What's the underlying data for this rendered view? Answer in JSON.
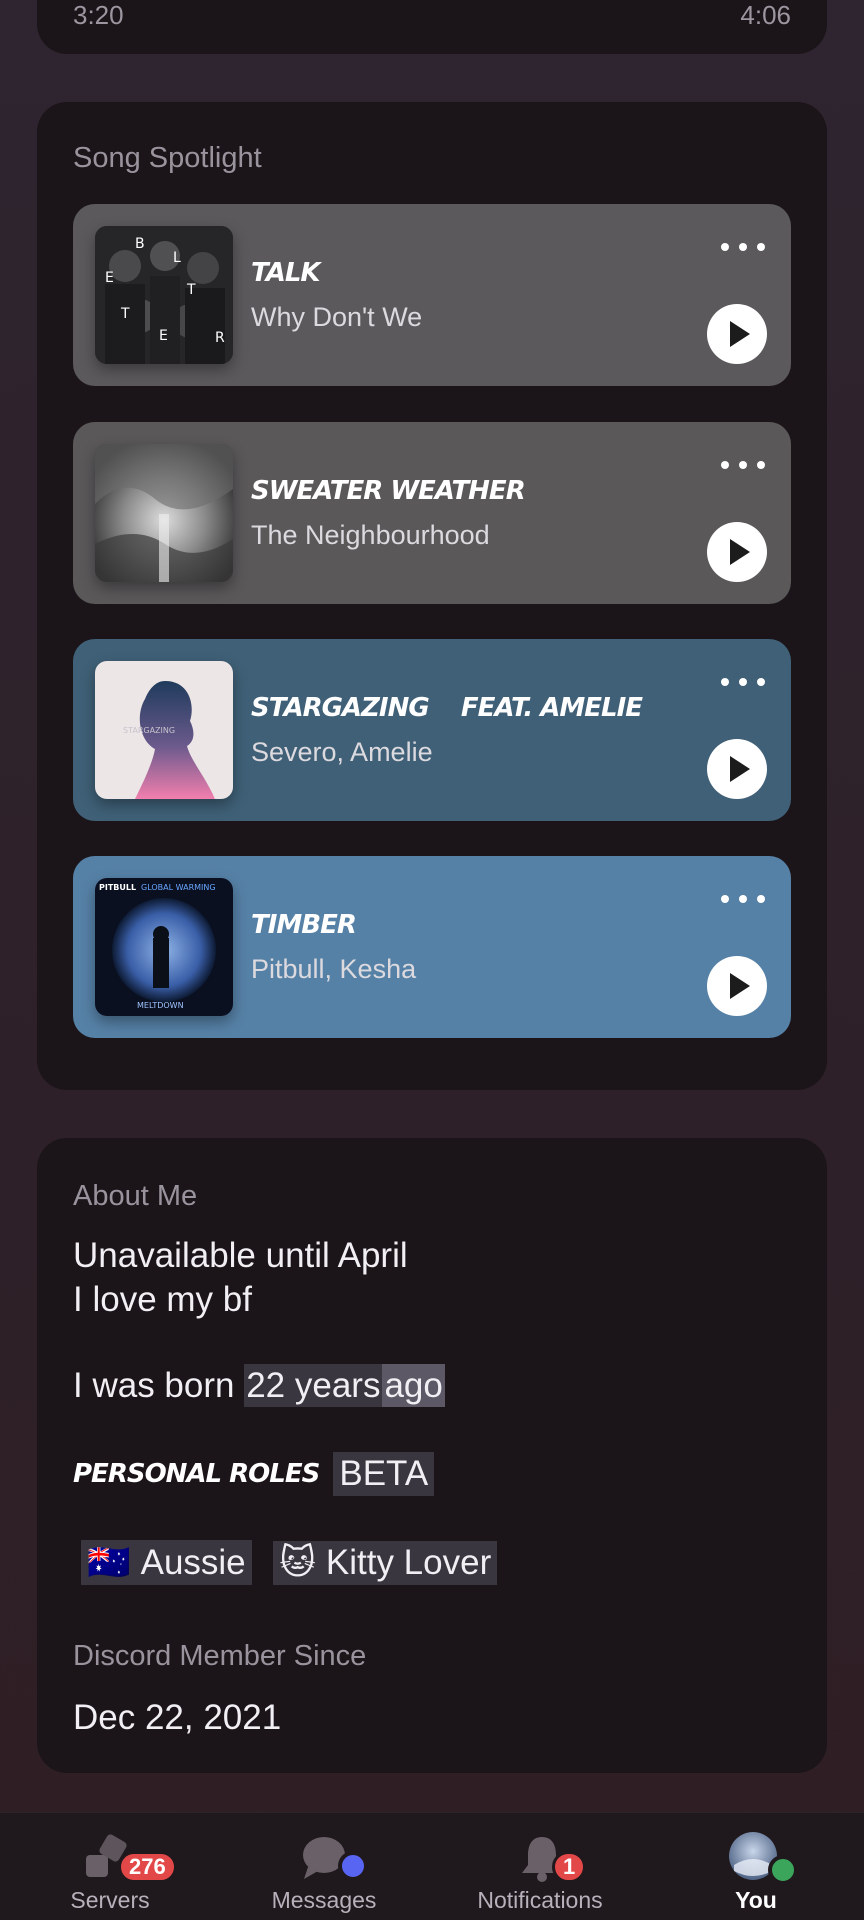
{
  "progress": {
    "elapsed": "3:20",
    "total": "4:06"
  },
  "spotlight": {
    "title": "Song Spotlight",
    "songs": [
      {
        "title": "TALK",
        "artist": "Why Don't We",
        "bg": "#5b595c"
      },
      {
        "title": "SWEATER WEATHER",
        "artist": "The Neighbourhood",
        "bg": "#5a5859"
      },
      {
        "title": "STARGAZING    FEAT. AMELIE",
        "artist": "Severo, Amelie",
        "bg": "#3f6077"
      },
      {
        "title": "TIMBER",
        "artist": "Pitbull, Kesha",
        "bg": "#5681a6"
      }
    ]
  },
  "about": {
    "title": "About Me",
    "line1": "Unavailable until April",
    "line2": "I love my bf",
    "born_prefix": "I was born",
    "born_highlight": "22 years",
    "born_suffix": "ago",
    "roles_label": "PERSONAL ROLES",
    "roles_badge": "BETA",
    "roles": [
      {
        "emoji": "🇦🇺",
        "label": "Aussie"
      },
      {
        "emoji": "🐱",
        "label": "Kitty Lover"
      }
    ],
    "member_since_label": "Discord Member Since",
    "member_since_value": "Dec 22, 2021"
  },
  "nav": {
    "servers": {
      "label": "Servers",
      "badge": "276"
    },
    "messages": {
      "label": "Messages"
    },
    "notifications": {
      "label": "Notifications",
      "badge": "1"
    },
    "you": {
      "label": "You"
    }
  },
  "colors": {
    "accent_blue": "#5865f2",
    "online_green": "#3ba55c",
    "badge_red": "#e34848"
  }
}
